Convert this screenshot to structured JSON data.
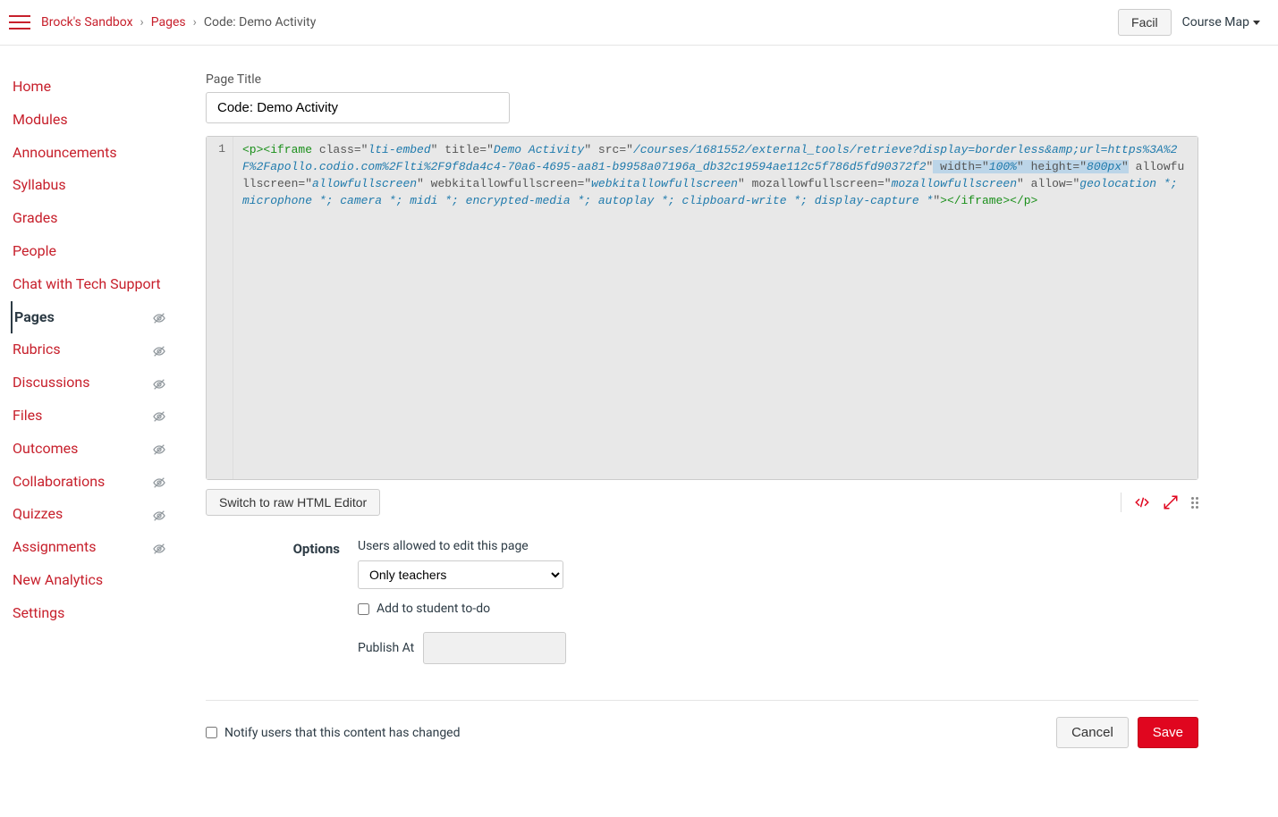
{
  "breadcrumb": {
    "sandbox": "Brock's Sandbox",
    "pages": "Pages",
    "current": "Code: Demo Activity"
  },
  "topbar": {
    "facil": "Facil",
    "course_map": "Course Map"
  },
  "sidenav": [
    {
      "label": "Home",
      "hidden": false,
      "active": false
    },
    {
      "label": "Modules",
      "hidden": false,
      "active": false
    },
    {
      "label": "Announcements",
      "hidden": false,
      "active": false
    },
    {
      "label": "Syllabus",
      "hidden": false,
      "active": false
    },
    {
      "label": "Grades",
      "hidden": false,
      "active": false
    },
    {
      "label": "People",
      "hidden": false,
      "active": false
    },
    {
      "label": "Chat with Tech Support",
      "hidden": false,
      "active": false
    },
    {
      "label": "Pages",
      "hidden": true,
      "active": true
    },
    {
      "label": "Rubrics",
      "hidden": true,
      "active": false
    },
    {
      "label": "Discussions",
      "hidden": true,
      "active": false
    },
    {
      "label": "Files",
      "hidden": true,
      "active": false
    },
    {
      "label": "Outcomes",
      "hidden": true,
      "active": false
    },
    {
      "label": "Collaborations",
      "hidden": true,
      "active": false
    },
    {
      "label": "Quizzes",
      "hidden": true,
      "active": false
    },
    {
      "label": "Assignments",
      "hidden": true,
      "active": false
    },
    {
      "label": "New Analytics",
      "hidden": false,
      "active": false
    },
    {
      "label": "Settings",
      "hidden": false,
      "active": false
    }
  ],
  "page_title_label": "Page Title",
  "page_title_value": "Code: Demo Activity",
  "code": {
    "line_no": "1",
    "tokens": {
      "p_open": "<p>",
      "iframe_open": "<iframe",
      "class_attr": " class",
      "class_val": "lti-embed",
      "title_attr": " title",
      "title_val": "Demo Activity",
      "src_attr": " src",
      "src_val": "/courses/1681552/external_tools/retrieve?display=borderless&amp;url=https%3A%2F%2Fapollo.codio.com%2Flti%2F9f8da4c4-70a6-4695-aa81-b9958a07196a_db32c19594ae112c5f786d5fd90372f2",
      "width_attr": " width",
      "width_val": "100%",
      "height_attr": " height",
      "height_val": "800px",
      "allowfs_attr": " allowfullscreen",
      "allowfs_val": "allowfullscreen",
      "webkit_attr": " webkitallowfullscreen",
      "webkit_val": "webkitallowfullscreen",
      "moz_attr": " mozallowfullscreen",
      "moz_val": "mozallowfullscreen",
      "allow_attr": " allow",
      "allow_val": "geolocation *; microphone *; camera *; midi *; encrypted-media *; autoplay *; clipboard-write *; display-capture *",
      "iframe_close": "></iframe>",
      "p_close": "</p>"
    }
  },
  "editor_footer": {
    "switch_button": "Switch to raw HTML Editor"
  },
  "options": {
    "label": "Options",
    "hint": "Users allowed to edit this page",
    "select_value": "Only teachers",
    "todo_label": "Add to student to-do",
    "publish_label": "Publish At"
  },
  "footer": {
    "notify_label": "Notify users that this content has changed",
    "cancel": "Cancel",
    "save": "Save"
  },
  "colors": {
    "brand": "#c7202c",
    "primary_btn": "#e0061f",
    "code_bg": "#e8e8e8"
  }
}
